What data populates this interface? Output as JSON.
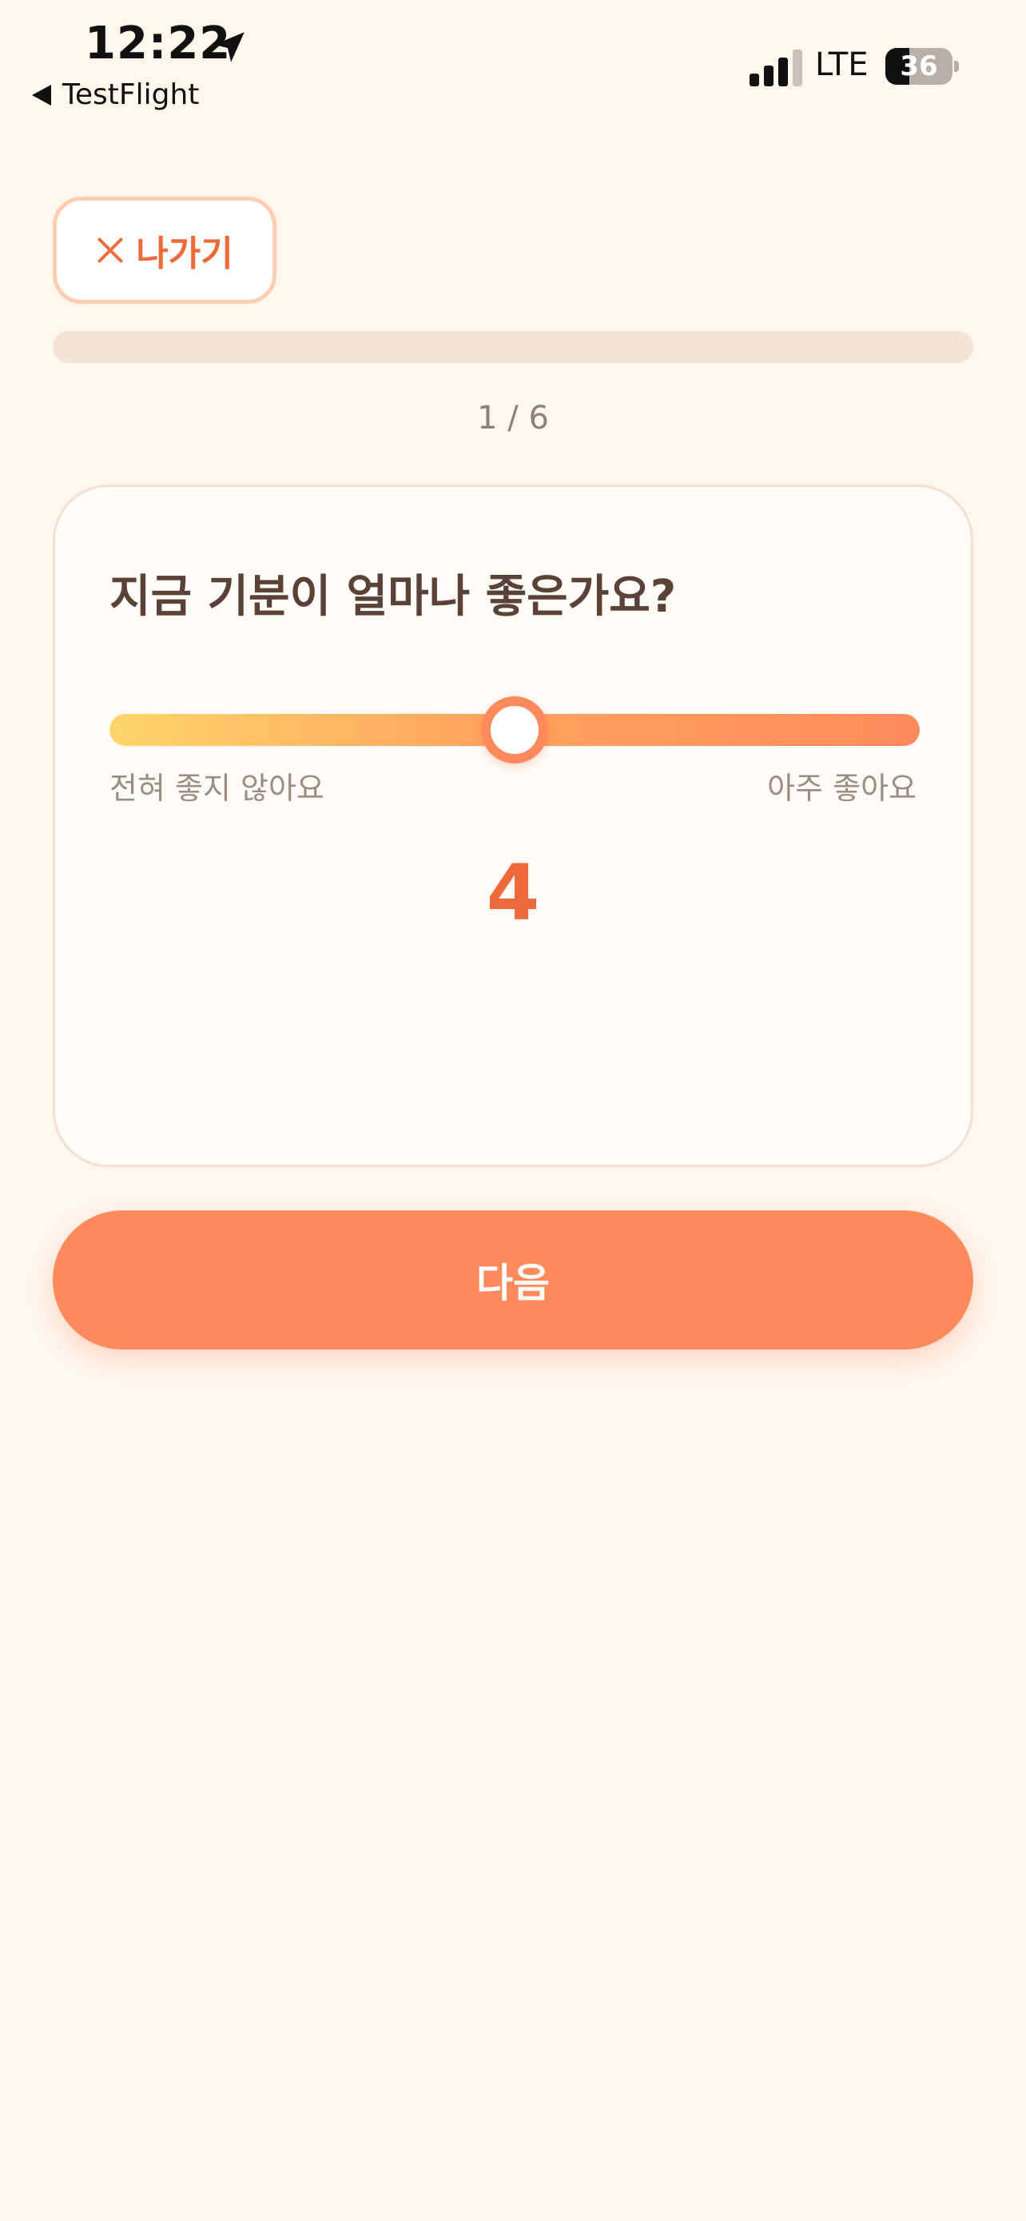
{
  "status_bar": {
    "time": "12:22",
    "back_app": "TestFlight",
    "network": "LTE",
    "battery": 36,
    "battery_label": "36",
    "icons": [
      "location-arrow-icon",
      "back-triangle-icon",
      "cellular-signal-icon",
      "battery-icon"
    ]
  },
  "header": {
    "exit_label": "나가기",
    "exit_icon": "close-icon"
  },
  "progress": {
    "current": 1,
    "total": 6,
    "fraction": 0,
    "label": "1 / 6"
  },
  "question": {
    "title": "지금 기분이 얼마나 좋은가요?",
    "slider": {
      "min_label": "전혀 좋지 않아요",
      "max_label": "아주 좋아요",
      "min": 1,
      "max": 7,
      "value": 4,
      "value_label": "4"
    }
  },
  "footer": {
    "next_label": "다음"
  },
  "colors": {
    "background": "#fff6ec",
    "accent": "#ff8a5c",
    "accent_text": "#ee6a3b",
    "slider_start": "#ffd56a",
    "title_text": "#5a4238"
  }
}
